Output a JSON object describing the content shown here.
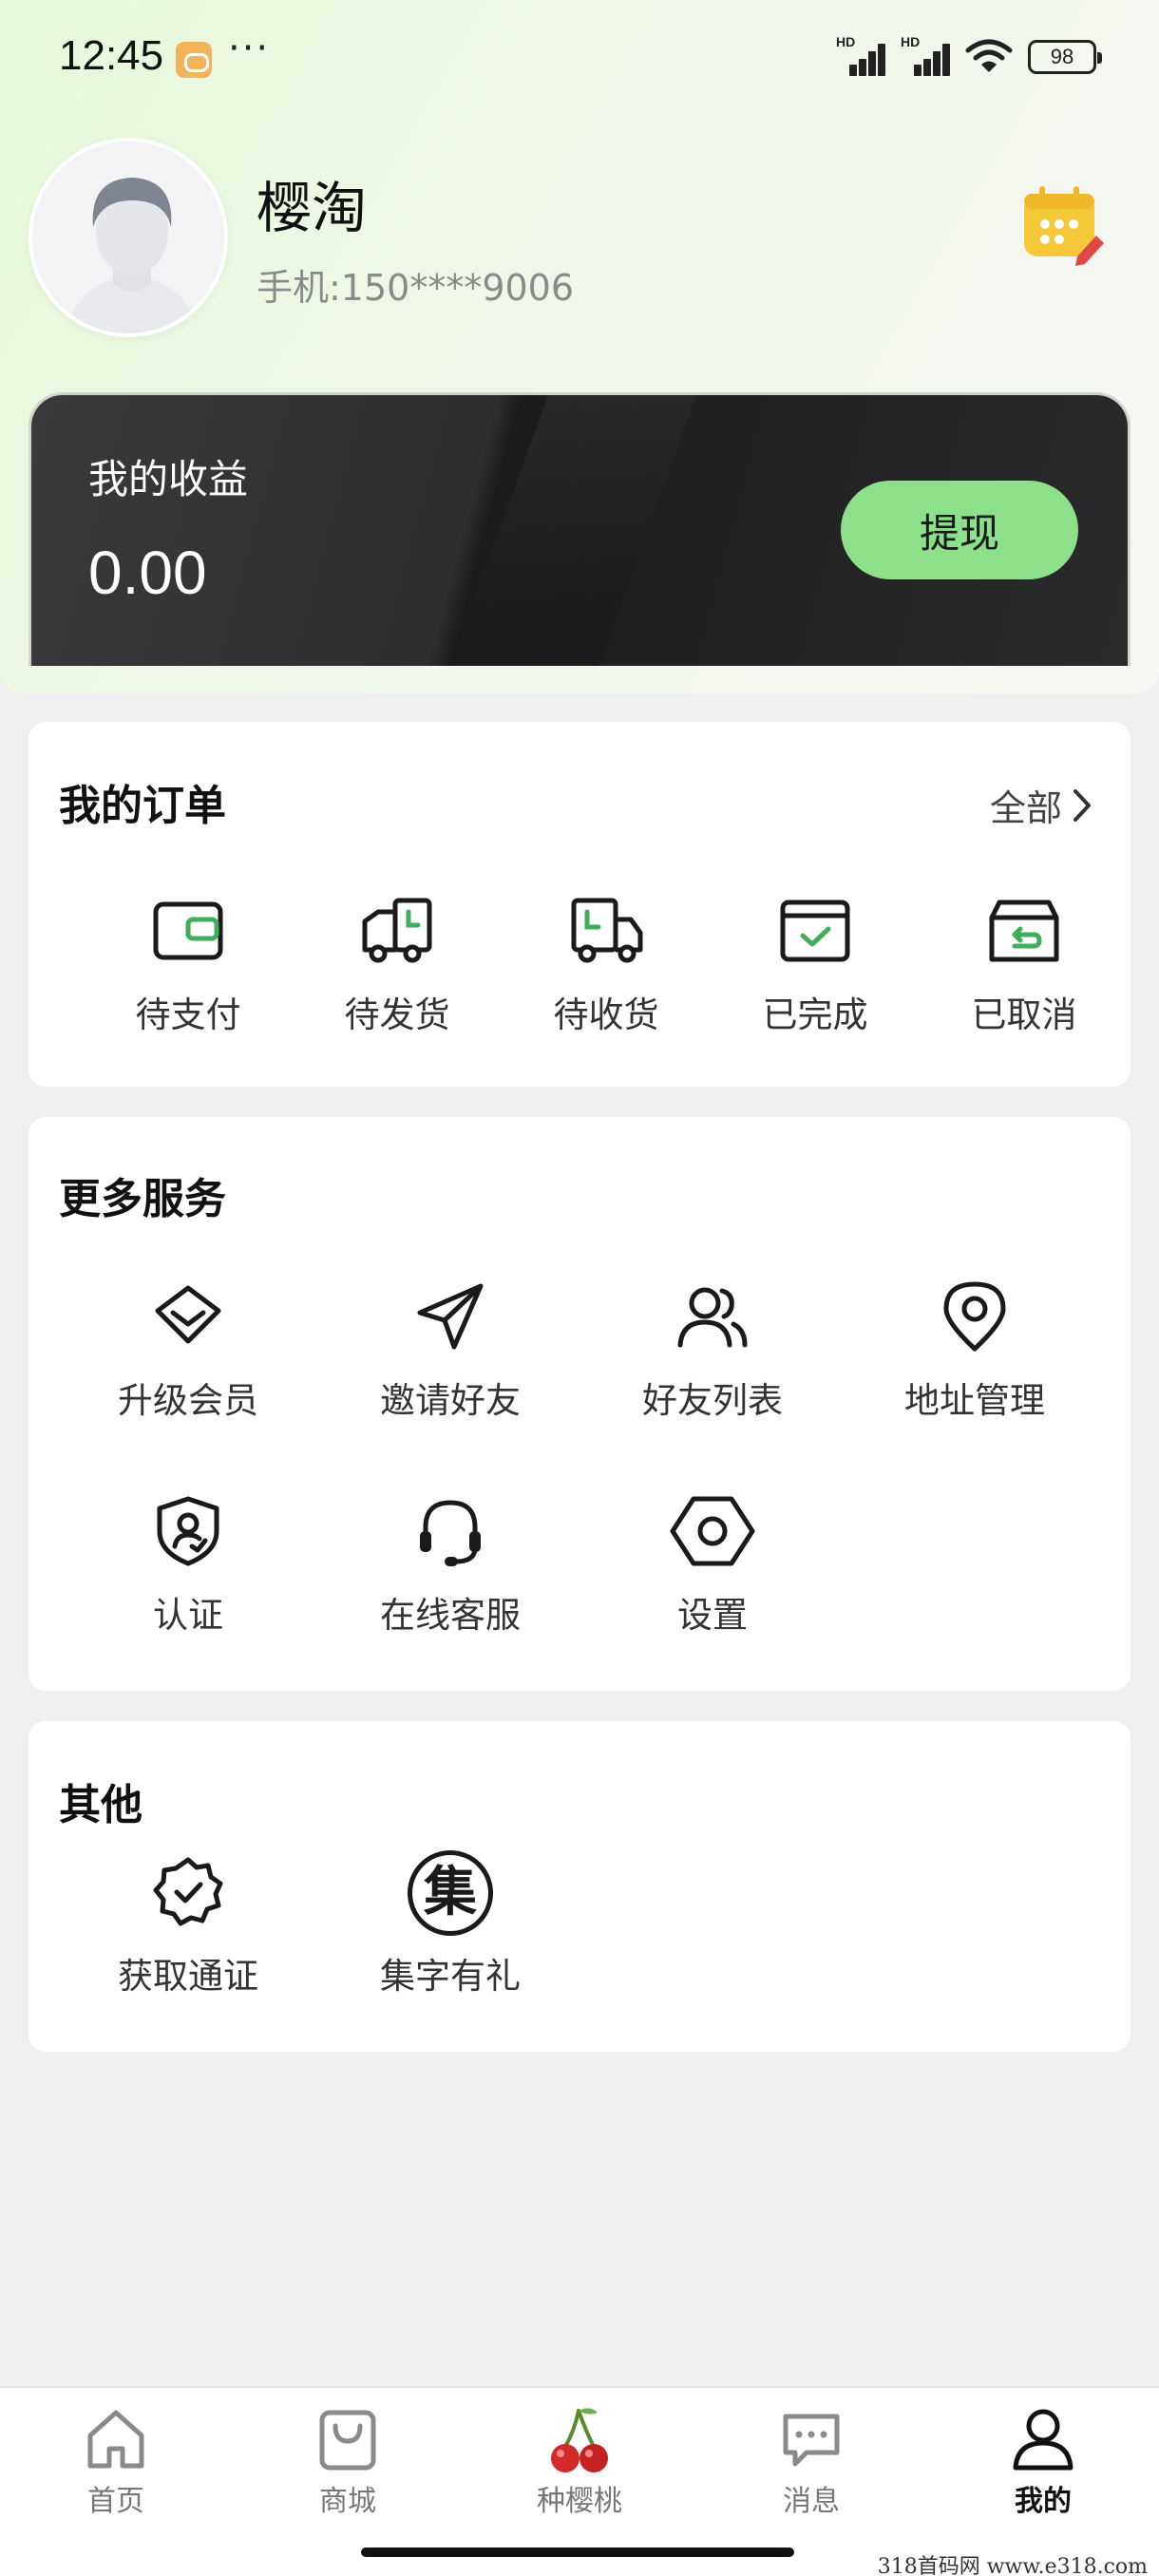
{
  "status_bar": {
    "time": "12:45",
    "dots": "···",
    "signal_1_label": "HD",
    "signal_2_label": "HD",
    "battery": "98"
  },
  "profile": {
    "username": "樱淘",
    "phone": "手机:150****9006"
  },
  "earnings": {
    "label": "我的收益",
    "value": "0.00",
    "withdraw_label": "提现"
  },
  "orders": {
    "title": "我的订单",
    "all_label": "全部",
    "items": [
      {
        "label": "待支付",
        "icon": "wallet-icon"
      },
      {
        "label": "待发货",
        "icon": "delivery-truck-clock-icon"
      },
      {
        "label": "待收货",
        "icon": "receiving-truck-icon"
      },
      {
        "label": "已完成",
        "icon": "completed-check-icon"
      },
      {
        "label": "已取消",
        "icon": "cancelled-return-icon"
      }
    ]
  },
  "services": {
    "title": "更多服务",
    "items": [
      {
        "label": "升级会员",
        "icon": "diamond-icon"
      },
      {
        "label": "邀请好友",
        "icon": "paper-plane-icon"
      },
      {
        "label": "好友列表",
        "icon": "friends-icon"
      },
      {
        "label": "地址管理",
        "icon": "location-pin-icon"
      },
      {
        "label": "认证",
        "icon": "shield-user-icon"
      },
      {
        "label": "在线客服",
        "icon": "headset-icon"
      },
      {
        "label": "设置",
        "icon": "settings-hexagon-icon"
      }
    ]
  },
  "others": {
    "title": "其他",
    "items": [
      {
        "label": "获取通证",
        "icon": "badge-check-icon"
      },
      {
        "label": "集字有礼",
        "icon": "collect-character-icon",
        "glyph": "集"
      }
    ]
  },
  "bottom_nav": {
    "items": [
      {
        "label": "首页",
        "icon": "home-icon"
      },
      {
        "label": "商城",
        "icon": "shopping-bag-icon"
      },
      {
        "label": "种樱桃",
        "icon": "cherry-icon"
      },
      {
        "label": "消息",
        "icon": "message-icon"
      },
      {
        "label": "我的",
        "icon": "profile-icon",
        "active": true
      }
    ]
  },
  "watermark": "318首码网  www.e318.com",
  "colors": {
    "accent_green": "#8de08a",
    "icon_green": "#3fae5c",
    "card_dark": "#2a2a2c"
  }
}
